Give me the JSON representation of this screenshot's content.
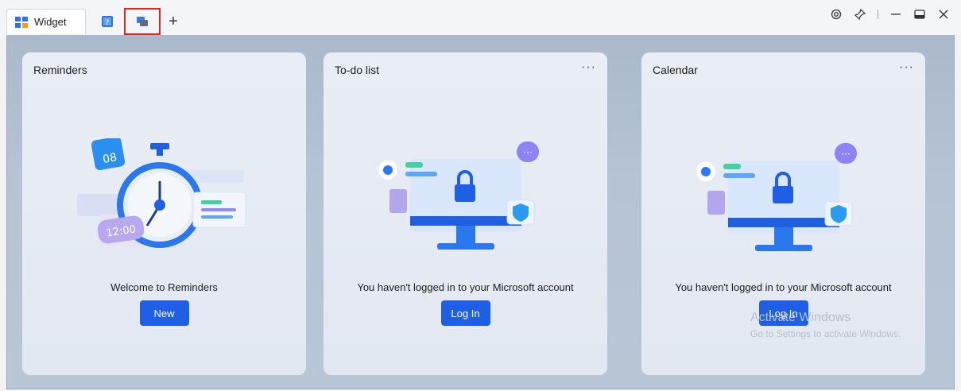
{
  "titlebar": {
    "tab_widget_label": "Widget",
    "add_tab_label": "+"
  },
  "cards": {
    "reminders": {
      "title": "Reminders",
      "calendar_day": "08",
      "clock_time": "12:00",
      "message": "Welcome to Reminders",
      "button": "New"
    },
    "todo": {
      "title": "To-do list",
      "more": "···",
      "message": "You haven't logged in to your Microsoft account",
      "button": "Log In"
    },
    "calendar": {
      "title": "Calendar",
      "more": "···",
      "message": "You haven't logged in to your Microsoft account",
      "button": "Log In"
    }
  },
  "watermark": {
    "line1": "Activate Windows",
    "line2": "Go to Settings to activate Windows."
  },
  "colors": {
    "accent": "#1e5fe6",
    "selection_outline": "#e1261c"
  }
}
